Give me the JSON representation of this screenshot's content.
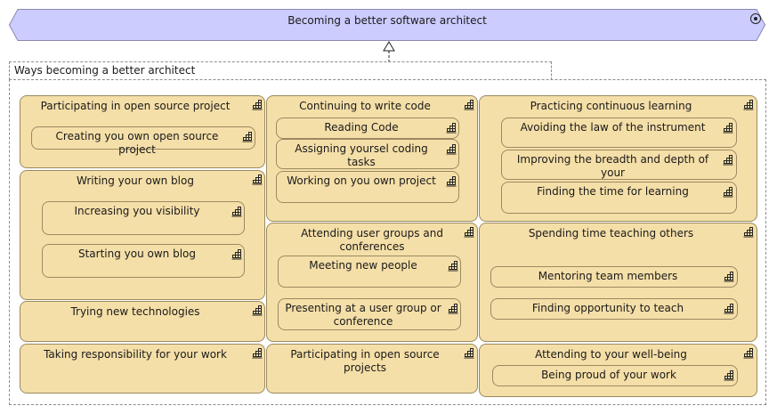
{
  "goal": {
    "title": "Becoming a better software architect",
    "icon": "goal-target-icon"
  },
  "group": {
    "label": "Ways becoming a better architect"
  },
  "colors": {
    "goal_fill": "#ccccff",
    "box_fill": "#f5dfa8"
  },
  "columns": {
    "left": {
      "open_source": {
        "title": "Participating in open source project",
        "children": [
          "Creating you own open source project"
        ]
      },
      "blog": {
        "title": "Writing your own blog",
        "children": [
          "Increasing you visibility",
          "Starting you own blog"
        ]
      },
      "new_tech": {
        "title": "Trying new technologies"
      },
      "responsibility": {
        "title": "Taking responsibility for your work"
      }
    },
    "middle": {
      "code": {
        "title": "Continuing to write code",
        "children": [
          "Reading Code",
          "Assigning yoursel coding tasks",
          "Working on you own project"
        ]
      },
      "user_groups": {
        "title": "Attending user groups and conferences",
        "children": [
          "Meeting new people",
          "Presenting at a user group or conference"
        ]
      },
      "open_source_projects": {
        "title": "Participating in open source projects"
      }
    },
    "right": {
      "learning": {
        "title": "Practicing continuous learning",
        "children": [
          "Avoiding the law of the instrument",
          "Improving the breadth and depth of your",
          "Finding the time for learning"
        ]
      },
      "teaching": {
        "title": "Spending time teaching others",
        "children": [
          "Mentoring team members",
          "Finding opportunity to teach"
        ]
      },
      "wellbeing": {
        "title": "Attending to your well-being",
        "children": [
          "Being proud of your work"
        ]
      }
    }
  }
}
